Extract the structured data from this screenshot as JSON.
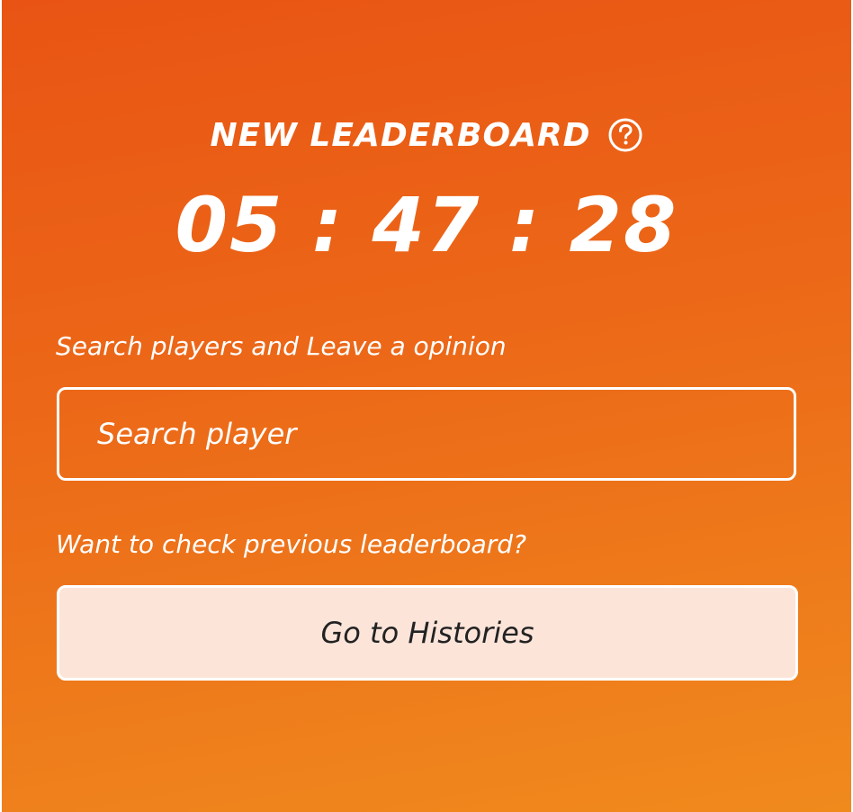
{
  "header": {
    "title": "NEW LEADERBOARD",
    "help_icon": "question-circle-icon"
  },
  "countdown": {
    "hours": "05",
    "minutes": "47",
    "seconds": "28",
    "display": "05 : 47 : 28"
  },
  "search": {
    "label": "Search players and Leave a opinion",
    "placeholder": "Search player",
    "value": ""
  },
  "history": {
    "label": "Want to check previous leaderboard?",
    "button_label": "Go to Histories"
  },
  "colors": {
    "background_top": "#e95414",
    "background_bottom": "#f08a1d",
    "button_background": "#fde4d9",
    "text": "#ffffff",
    "button_text": "#222222"
  }
}
